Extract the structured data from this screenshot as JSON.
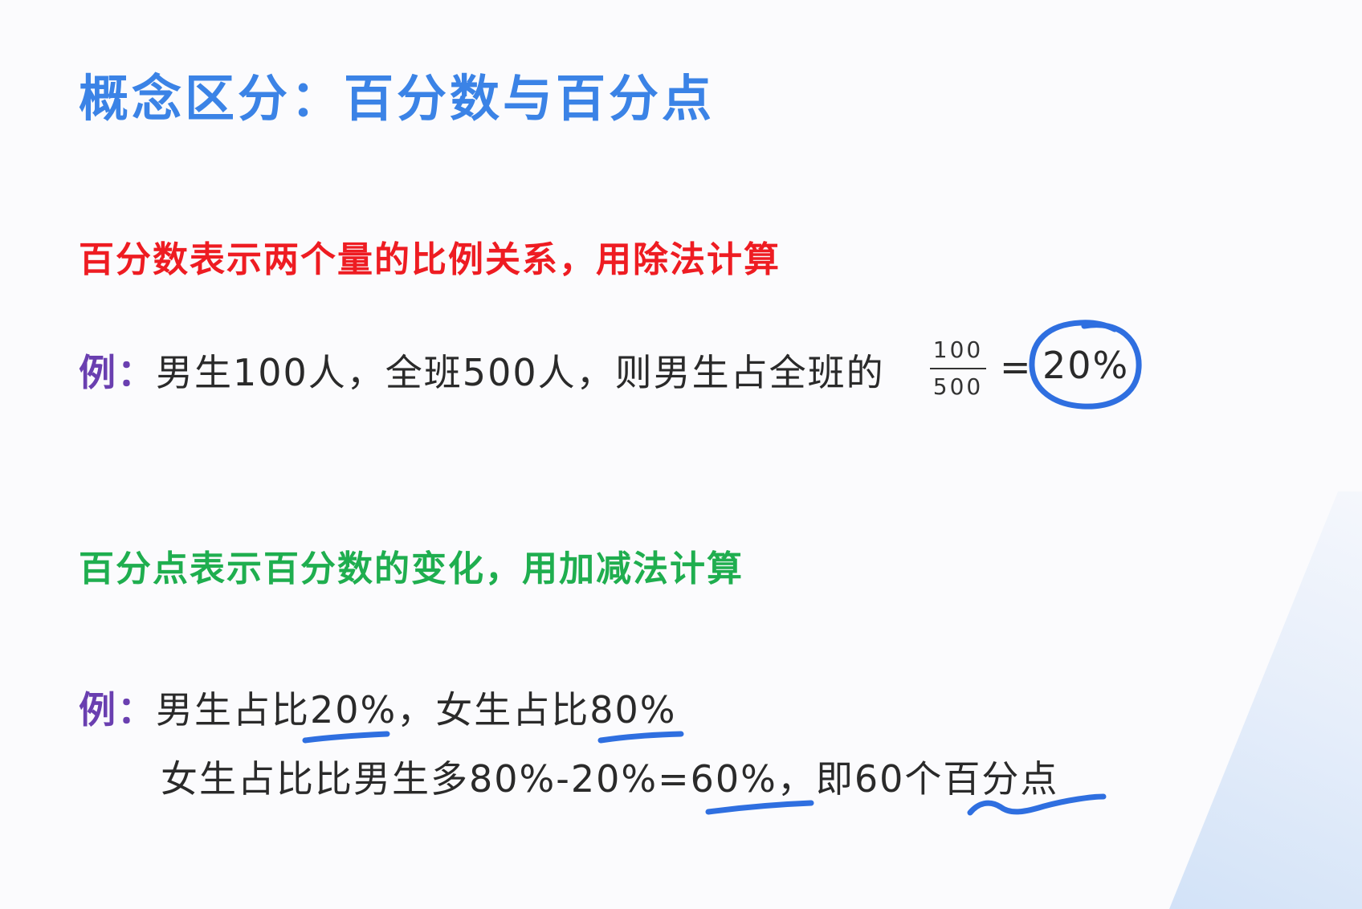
{
  "title": "概念区分：百分数与百分点",
  "percentage_rule": "百分数表示两个量的比例关系，用除法计算",
  "example1": {
    "label": "例：",
    "text": "男生100人，全班500人，则男生占全班的",
    "numerator": "100",
    "denominator": "500",
    "equals": "=",
    "result": "20%"
  },
  "percentage_point_rule": "百分点表示百分数的变化，用加减法计算",
  "example2": {
    "label": "例：",
    "line1": "男生占比20%，女生占比80%",
    "line2": "女生占比比男生多80%-20%=60%，即60个百分点"
  },
  "colors": {
    "title": "#3b83e6",
    "percentage_rule": "#ee1c22",
    "percentage_point_rule": "#1fae4f",
    "example_label": "#6a3fb0",
    "annotation_ink": "#2f6fe0"
  }
}
